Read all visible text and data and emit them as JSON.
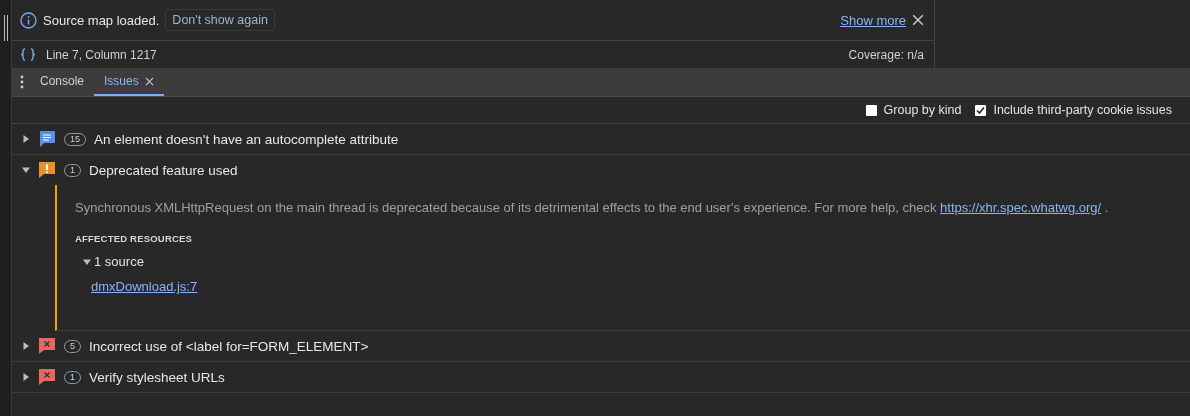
{
  "infobar": {
    "message": "Source map loaded.",
    "dismiss_button": "Don't show again",
    "link": "Show more"
  },
  "status_bar": {
    "position": "Line 7, Column 1217",
    "coverage": "Coverage: n/a"
  },
  "tabs": [
    {
      "label": "Console",
      "selected": false,
      "closable": false
    },
    {
      "label": "Issues",
      "selected": true,
      "closable": true
    }
  ],
  "options": [
    {
      "label": "Group by kind",
      "checked": false
    },
    {
      "label": "Include third-party cookie issues",
      "checked": true
    }
  ],
  "issues": [
    {
      "kind": "info",
      "count": "15",
      "title": "An element doesn't have an autocomplete attribute",
      "expanded": false
    },
    {
      "kind": "warning",
      "count": "1",
      "title": "Deprecated feature used",
      "expanded": true,
      "description_before": "Synchronous XMLHttpRequest on the main thread is deprecated because of its detrimental effects to the end user's experience. For more help, check ",
      "description_link": "https://xhr.spec.whatwg.org/",
      "description_after": " .",
      "affected_heading": "AFFECTED RESOURCES",
      "sources": {
        "label": "1 source",
        "expanded": true,
        "items": [
          "dmxDownload.js:7"
        ]
      }
    },
    {
      "kind": "error",
      "count": "5",
      "title": "Incorrect use of <label for=FORM_ELEMENT>",
      "expanded": false
    },
    {
      "kind": "error",
      "count": "1",
      "title": "Verify stylesheet URLs",
      "expanded": false
    }
  ]
}
